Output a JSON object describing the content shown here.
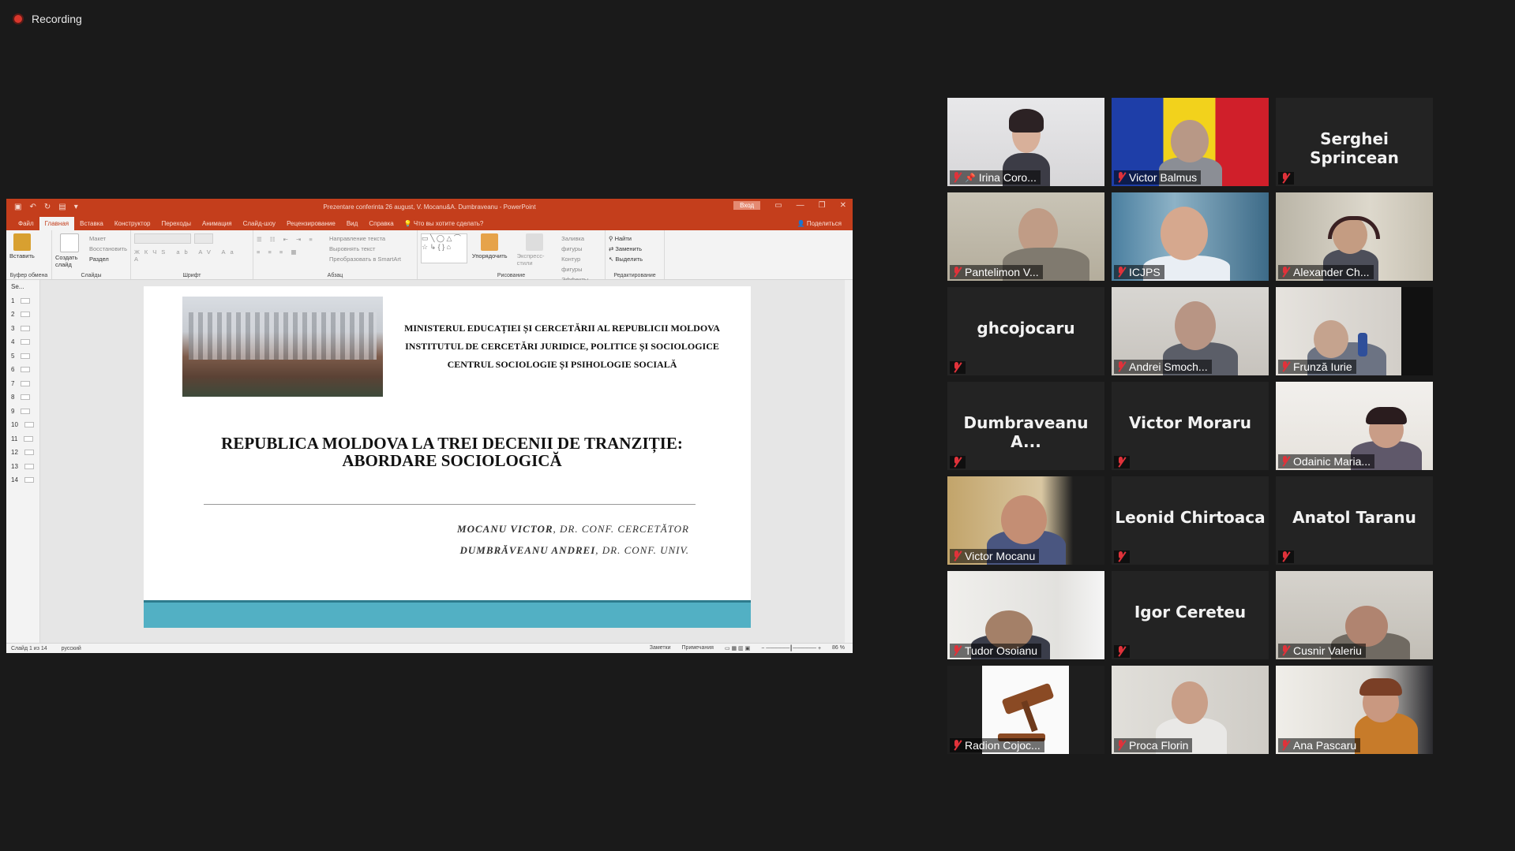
{
  "recording": {
    "label": "Recording"
  },
  "powerpoint": {
    "title": "Prezentare conferinta 26 august, V. Mocanu&A. Dumbraveanu  -  PowerPoint",
    "login": "Вход",
    "tabs": [
      "Файл",
      "Главная",
      "Вставка",
      "Конструктор",
      "Переходы",
      "Анимация",
      "Слайд-шоу",
      "Рецензирование",
      "Вид",
      "Справка"
    ],
    "tell_me": "Что вы хотите сделать?",
    "share": "Поделиться",
    "groups": {
      "clipboard": "Буфер обмена",
      "slides": "Слайды",
      "font": "Шрифт",
      "paragraph": "Абзац",
      "drawing": "Рисование",
      "editing": "Редактирование"
    },
    "buttons": {
      "paste": "Вставить",
      "new_slide": "Создать слайд",
      "layout": "Макет",
      "reset": "Восстановить",
      "section": "Раздел",
      "arrange": "Упорядочить",
      "quick_styles": "Экспресс-стили",
      "find": "Найти",
      "replace": "Заменить",
      "select": "Выделить",
      "text_direction": "Направление текста",
      "align_text": "Выровнять текст",
      "smartart": "Преобразовать в SmartArt",
      "shape_fill": "Заливка фигуры",
      "shape_outline": "Контур фигуры",
      "shape_effects": "Эффекты фигуры"
    },
    "thumbnails_header": "Se...",
    "slide_numbers": [
      "1",
      "2",
      "3",
      "4",
      "5",
      "6",
      "7",
      "8",
      "9",
      "10",
      "11",
      "12",
      "13",
      "14"
    ],
    "status": {
      "slide": "Слайд 1 из 14",
      "language": "русский",
      "notes": "Заметки",
      "comments": "Примечания",
      "zoom": "86 %"
    }
  },
  "slide": {
    "ministry_lines": [
      "MINISTERUL EDUCAȚIEI ȘI CERCETĂRII AL REPUBLICII MOLDOVA",
      "INSTITUTUL DE CERCETĂRI JURIDICE, POLITICE ȘI SOCIOLOGICE",
      "CENTRUL SOCIOLOGIE ȘI PSIHOLOGIE SOCIALĂ"
    ],
    "title_line1": "REPUBLICA MOLDOVA LA TREI DECENII DE TRANZIȚIE:",
    "title_line2": "ABORDARE SOCIOLOGICĂ",
    "author1_name": "MOCANU VICTOR",
    "author1_title": ", DR. CONF. CERCETĂTOR",
    "author2_name": "DUMBRĂVEANU ANDREI",
    "author2_title": ", DR. CONF. UNIV."
  },
  "participants": [
    {
      "name": "Irina Coro...",
      "pinned": true,
      "video": true
    },
    {
      "name": "Victor Balmus",
      "video": true
    },
    {
      "name": "Serghei Sprincean",
      "display": "Serghei Sprincean",
      "video": false
    },
    {
      "name": "Pantelimon V...",
      "video": true
    },
    {
      "name": "ICJPS",
      "video": true,
      "active": true
    },
    {
      "name": "Alexander Ch...",
      "video": true
    },
    {
      "name": "ghcojocaru",
      "display": "ghcojocaru",
      "video": false
    },
    {
      "name": "Andrei Smoch...",
      "video": true
    },
    {
      "name": "Frunză Iurie",
      "video": true
    },
    {
      "name": "Dumbraveanu A...",
      "display": "Dumbraveanu  A...",
      "video": false
    },
    {
      "name": "Victor Moraru",
      "display": "Victor Moraru",
      "video": false
    },
    {
      "name": "Odainic Maria...",
      "video": true
    },
    {
      "name": "Victor Mocanu",
      "video": true
    },
    {
      "name": "Leonid Chirtoaca",
      "display": "Leonid Chirtoaca",
      "video": false
    },
    {
      "name": "Anatol Taranu",
      "display": "Anatol Taranu",
      "video": false
    },
    {
      "name": "Tudor Osoianu",
      "video": true
    },
    {
      "name": "Igor Cereteu",
      "display": "Igor Cereteu",
      "video": false
    },
    {
      "name": "Cusnir Valeriu",
      "video": true
    },
    {
      "name": "Radion Cojoc...",
      "video": true
    },
    {
      "name": "Proca Florin",
      "video": true
    },
    {
      "name": "Ana Pascaru",
      "video": true
    }
  ],
  "colors": {
    "ppt_accent": "#c43e1c",
    "active_speaker": "#d9d434",
    "muted": "#e0323a",
    "slide_band": "#52b0c4"
  }
}
